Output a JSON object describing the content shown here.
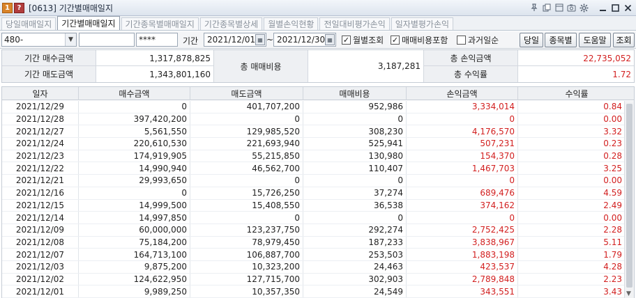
{
  "window": {
    "badge_one": "1",
    "badge_help": "?",
    "title": "[0613] 기간별매매일지"
  },
  "tabs": [
    {
      "label": "당일매매일지"
    },
    {
      "label": "기간별매매일지",
      "active": true
    },
    {
      "label": "기간종목별매매일지"
    },
    {
      "label": "기간종목별상세"
    },
    {
      "label": "월별손익현황"
    },
    {
      "label": "전일대비평가손익"
    },
    {
      "label": "일자별평가손익"
    }
  ],
  "filters": {
    "account_value": "480-",
    "name_value": "",
    "password_value": "****",
    "period_label": "기간",
    "start_date": "2021/12/01",
    "tilde": "~",
    "end_date": "2021/12/30",
    "monthly_label": "월별조회",
    "monthly_checked": true,
    "fee_label": "매매비용포함",
    "fee_checked": true,
    "past_label": "과거일순",
    "past_checked": false
  },
  "buttons": {
    "today": "당일",
    "by_stock": "종목별",
    "help": "도움말",
    "query": "조회"
  },
  "summary": {
    "buy_label": "기간 매수금액",
    "buy_value": "1,317,878,825",
    "sell_label": "기간 매도금액",
    "sell_value": "1,343,801,160",
    "cost_label": "총 매매비용",
    "cost_value": "3,187,281",
    "profit_label": "총 손익금액",
    "profit_value": "22,735,052",
    "rate_label": "총 수익률",
    "rate_value": "1.72"
  },
  "table": {
    "columns": [
      "일자",
      "매수금액",
      "매도금액",
      "매매비용",
      "손익금액",
      "수익률"
    ],
    "rows": [
      {
        "date": "2021/12/29",
        "buy": "0",
        "sell": "401,707,200",
        "cost": "952,986",
        "profit": "3,334,014",
        "rate": "0.84"
      },
      {
        "date": "2021/12/28",
        "buy": "397,420,200",
        "sell": "0",
        "cost": "0",
        "profit": "0",
        "rate": "0.00"
      },
      {
        "date": "2021/12/27",
        "buy": "5,561,550",
        "sell": "129,985,520",
        "cost": "308,230",
        "profit": "4,176,570",
        "rate": "3.32"
      },
      {
        "date": "2021/12/24",
        "buy": "220,610,530",
        "sell": "221,693,940",
        "cost": "525,941",
        "profit": "507,231",
        "rate": "0.23"
      },
      {
        "date": "2021/12/23",
        "buy": "174,919,905",
        "sell": "55,215,850",
        "cost": "130,980",
        "profit": "154,370",
        "rate": "0.28"
      },
      {
        "date": "2021/12/22",
        "buy": "14,990,940",
        "sell": "46,562,700",
        "cost": "110,407",
        "profit": "1,467,703",
        "rate": "3.25"
      },
      {
        "date": "2021/12/21",
        "buy": "29,993,650",
        "sell": "0",
        "cost": "0",
        "profit": "0",
        "rate": "0.00"
      },
      {
        "date": "2021/12/16",
        "buy": "0",
        "sell": "15,726,250",
        "cost": "37,274",
        "profit": "689,476",
        "rate": "4.59"
      },
      {
        "date": "2021/12/15",
        "buy": "14,999,500",
        "sell": "15,408,550",
        "cost": "36,538",
        "profit": "374,162",
        "rate": "2.49"
      },
      {
        "date": "2021/12/14",
        "buy": "14,997,850",
        "sell": "0",
        "cost": "0",
        "profit": "0",
        "rate": "0.00"
      },
      {
        "date": "2021/12/09",
        "buy": "60,000,000",
        "sell": "123,237,750",
        "cost": "292,274",
        "profit": "2,752,425",
        "rate": "2.28"
      },
      {
        "date": "2021/12/08",
        "buy": "75,184,200",
        "sell": "78,979,450",
        "cost": "187,233",
        "profit": "3,838,967",
        "rate": "5.11"
      },
      {
        "date": "2021/12/07",
        "buy": "164,713,100",
        "sell": "106,887,700",
        "cost": "253,503",
        "profit": "1,883,198",
        "rate": "1.79"
      },
      {
        "date": "2021/12/03",
        "buy": "9,875,200",
        "sell": "10,323,200",
        "cost": "24,463",
        "profit": "423,537",
        "rate": "4.28"
      },
      {
        "date": "2021/12/02",
        "buy": "124,622,950",
        "sell": "127,715,700",
        "cost": "302,903",
        "profit": "2,789,848",
        "rate": "2.23"
      },
      {
        "date": "2021/12/01",
        "buy": "9,989,250",
        "sell": "10,357,350",
        "cost": "24,549",
        "profit": "343,551",
        "rate": "3.43"
      }
    ]
  },
  "colors": {
    "profit_positive": "#d21f1f",
    "header_bg": "#eef0f3"
  },
  "icons": [
    "pin-icon",
    "copy-icon",
    "window-icon",
    "camera-icon",
    "gear-icon",
    "minimize-icon",
    "maximize-icon",
    "close-icon"
  ]
}
